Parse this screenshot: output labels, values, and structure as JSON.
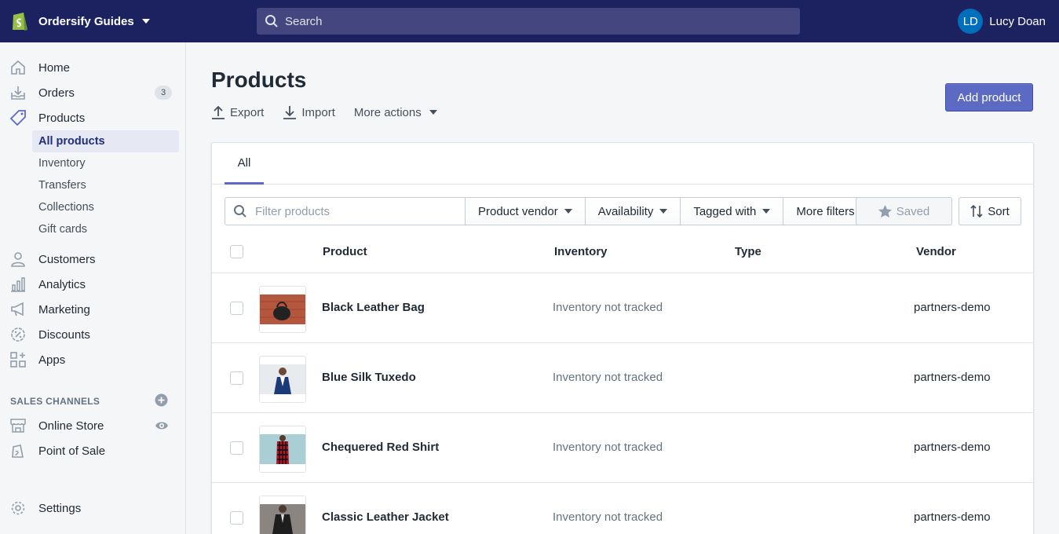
{
  "topbar": {
    "store_name": "Ordersify Guides",
    "search_placeholder": "Search",
    "user_initials": "LD",
    "user_name": "Lucy Doan"
  },
  "sidebar": {
    "items": [
      {
        "label": "Home",
        "icon": "home-icon"
      },
      {
        "label": "Orders",
        "icon": "orders-icon",
        "badge": "3"
      },
      {
        "label": "Products",
        "icon": "tag-icon"
      },
      {
        "label": "Customers",
        "icon": "person-icon"
      },
      {
        "label": "Analytics",
        "icon": "bar-chart-icon"
      },
      {
        "label": "Marketing",
        "icon": "megaphone-icon"
      },
      {
        "label": "Discounts",
        "icon": "discount-icon"
      },
      {
        "label": "Apps",
        "icon": "apps-icon"
      }
    ],
    "product_subitems": [
      "All products",
      "Inventory",
      "Transfers",
      "Collections",
      "Gift cards"
    ],
    "sales_channels_title": "SALES CHANNELS",
    "channels": [
      {
        "label": "Online Store",
        "icon": "store-icon"
      },
      {
        "label": "Point of Sale",
        "icon": "pos-bag-icon"
      }
    ],
    "settings_label": "Settings"
  },
  "page": {
    "title": "Products",
    "export_label": "Export",
    "import_label": "Import",
    "more_actions_label": "More actions",
    "add_product_label": "Add product"
  },
  "tabs": [
    "All"
  ],
  "filters": {
    "placeholder": "Filter products",
    "vendor": "Product vendor",
    "availability": "Availability",
    "tagged": "Tagged with",
    "more": "More filters",
    "saved": "Saved",
    "sort": "Sort"
  },
  "table": {
    "columns": [
      "Product",
      "Inventory",
      "Type",
      "Vendor"
    ],
    "rows": [
      {
        "name": "Black Leather Bag",
        "inventory": "Inventory not tracked",
        "type": "",
        "vendor": "partners-demo",
        "thumb_color": "#b5573e"
      },
      {
        "name": "Blue Silk Tuxedo",
        "inventory": "Inventory not tracked",
        "type": "",
        "vendor": "partners-demo",
        "thumb_color": "#e8ebee"
      },
      {
        "name": "Chequered Red Shirt",
        "inventory": "Inventory not tracked",
        "type": "",
        "vendor": "partners-demo",
        "thumb_color": "#a9cfd4"
      },
      {
        "name": "Classic Leather Jacket",
        "inventory": "Inventory not tracked",
        "type": "",
        "vendor": "partners-demo",
        "thumb_color": "#8a8580"
      }
    ]
  },
  "colors": {
    "topbar": "#1c2260",
    "primary": "#5c6ac4",
    "active_nav_bg": "#e6e8f4"
  }
}
